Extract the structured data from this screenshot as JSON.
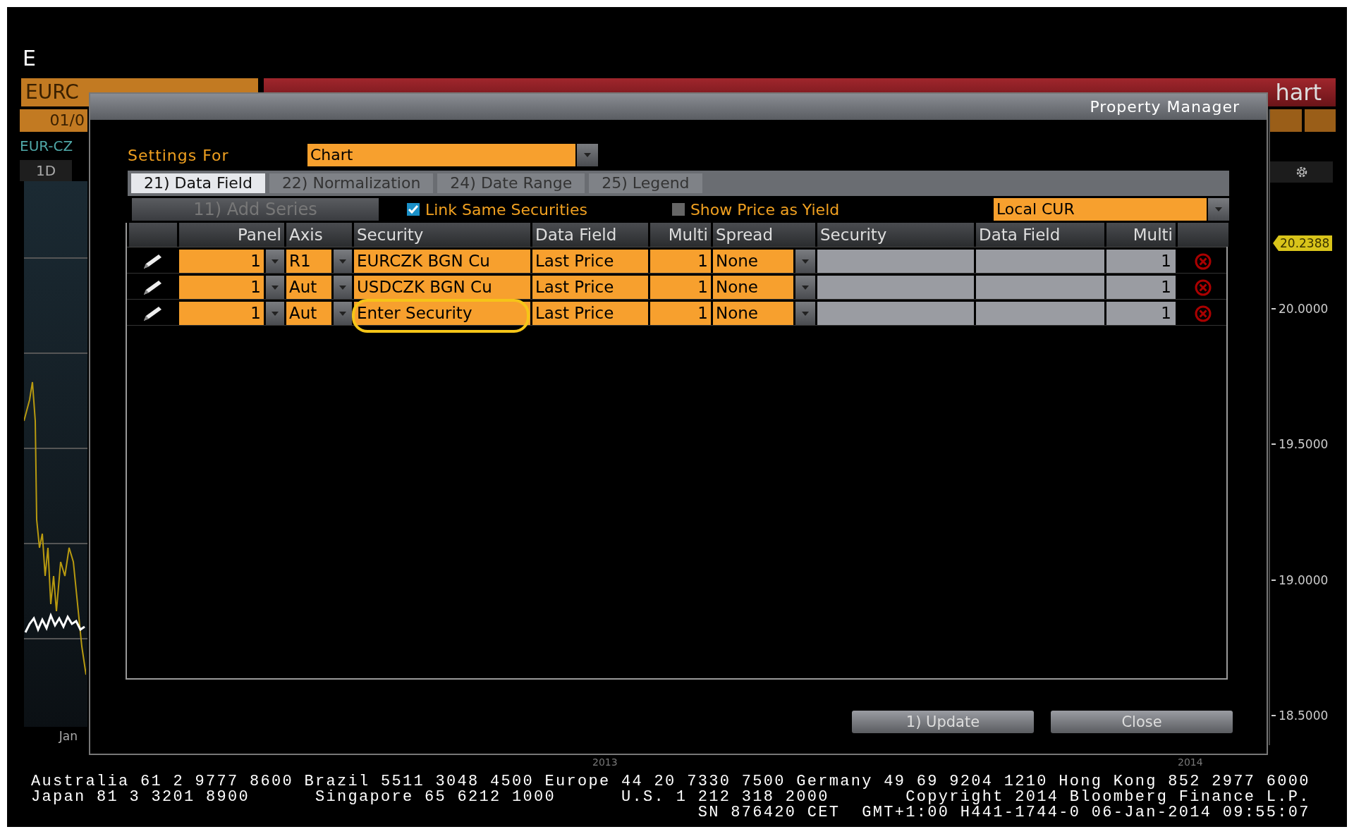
{
  "background": {
    "title_letter": "E",
    "security_header": "EURC",
    "date": "01/0",
    "ticker": "EUR-CZ",
    "period_button": "1D",
    "chart_title": "hart",
    "last_price_tag": "20.2388",
    "y_axis_labels": [
      "20.0000",
      "19.5000",
      "19.0000",
      "18.5000"
    ],
    "x_axis_start": "Jan",
    "x_axis_years": [
      "2013",
      "2014"
    ]
  },
  "dialog": {
    "title": "Property Manager",
    "settings_for": {
      "label": "Settings For",
      "value": "Chart"
    },
    "tabs": [
      {
        "label": "21) Data Field",
        "selected": true
      },
      {
        "label": "22) Normalization",
        "selected": false
      },
      {
        "label": "24) Date Range",
        "selected": false
      },
      {
        "label": "25) Legend",
        "selected": false
      }
    ],
    "add_series": {
      "label": "11) Add Series",
      "disabled": true
    },
    "options": [
      {
        "label": "Link Same Securities",
        "checked": true
      },
      {
        "label": "Show Price as Yield",
        "checked": false
      }
    ],
    "currency": "Local CUR",
    "columns": {
      "panel": "Panel",
      "axis": "Axis",
      "security": "Security",
      "data_field": "Data Field",
      "multi": "Multi",
      "spread": "Spread",
      "spread_security": "Security",
      "spread_data_field": "Data Field",
      "spread_multi": "Multi"
    },
    "rows": [
      {
        "panel": "1",
        "axis": "R1",
        "security": "EURCZK BGN Cu",
        "data_field": "Last Price",
        "multi": "1",
        "spread": "None",
        "spread_multi": "1",
        "annotated": false
      },
      {
        "panel": "1",
        "axis": "Aut",
        "security": "USDCZK BGN Cu",
        "data_field": "Last Price",
        "multi": "1",
        "spread": "None",
        "spread_multi": "1",
        "annotated": false
      },
      {
        "panel": "1",
        "axis": "Aut",
        "security": "Enter Security",
        "data_field": "Last Price",
        "multi": "1",
        "spread": "None",
        "spread_multi": "1",
        "annotated": true
      }
    ],
    "buttons": [
      "1) Update",
      "Close"
    ]
  },
  "footer": [
    "Australia 61 2 9777 8600 Brazil 5511 3048 4500 Europe 44 20 7330 7500 Germany 49 69 9204 1210 Hong Kong 852 2977 6000",
    "Japan 81 3 3201 8900      Singapore 65 6212 1000      U.S. 1 212 318 2000       Copyright 2014 Bloomberg Finance L.P.",
    "SN 876420 CET  GMT+1:00 H441-1744-0 06-Jan-2014 09:55:07"
  ]
}
